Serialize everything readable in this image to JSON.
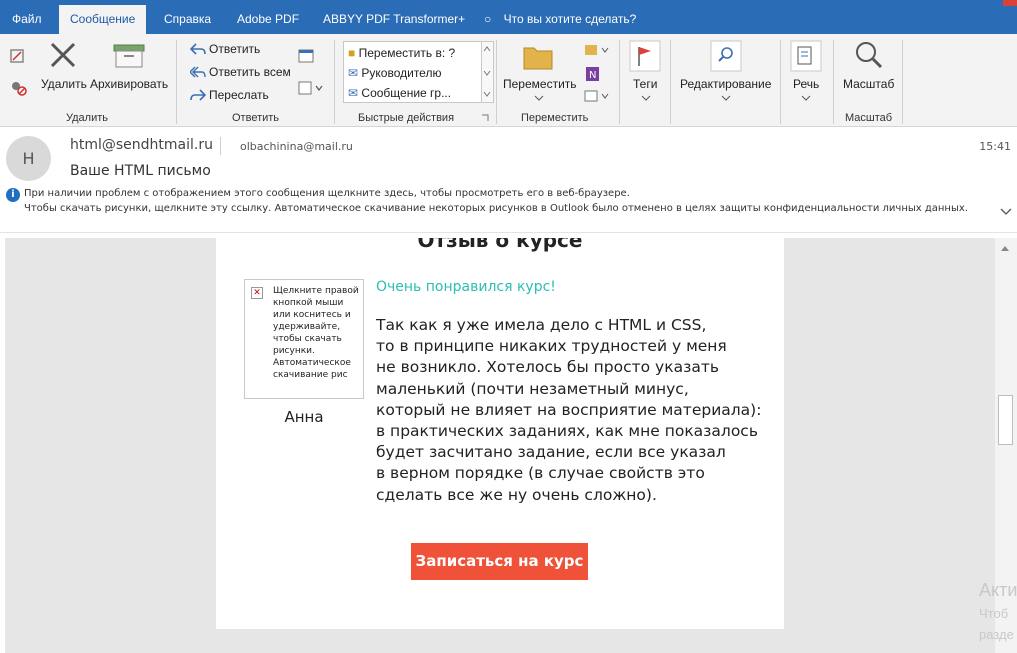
{
  "tabs": [
    {
      "label": "Файл"
    },
    {
      "label": "Сообщение"
    },
    {
      "label": "Справка"
    },
    {
      "label": "Adobe PDF"
    },
    {
      "label": "ABBYY PDF Transformer+"
    },
    {
      "label": "Что вы хотите сделать?"
    }
  ],
  "ribbon": {
    "delete_group": {
      "delete_label": "Удалить",
      "archive_label": "Архивировать",
      "group_label": "Удалить"
    },
    "respond_group": {
      "reply": "Ответить",
      "reply_all": "Ответить всем",
      "forward": "Переслать",
      "group_label": "Ответить"
    },
    "quick_steps": {
      "items": [
        "Переместить в: ?",
        "Руководителю",
        "Сообщение гр..."
      ],
      "group_label": "Быстрые действия"
    },
    "move_group": {
      "move_label": "Переместить",
      "group_label": "Переместить"
    },
    "tags_label": "Теги",
    "editing_label": "Редактирование",
    "speech_label": "Речь",
    "zoom": {
      "label": "Масштаб",
      "group_label": "Масштаб"
    }
  },
  "message": {
    "avatar_initial": "H",
    "sender": "html@sendhtmail.ru",
    "recipient": "olbachinina@mail.ru",
    "time": "15:41",
    "subject": "Ваше HTML письмо",
    "info_line1": "При наличии проблем с отображением этого сообщения щелкните здесь, чтобы просмотреть его в веб-браузере.",
    "info_line2": "Чтобы скачать рисунки, щелкните эту ссылку. Автоматическое скачивание некоторых рисунков в Outlook было отменено в целях защиты конфиденциальности личных данных."
  },
  "email_body": {
    "title": "Отзыв о курсе",
    "image_placeholder_text": "Щелкните правой кнопкой мыши или коснитесь и удерживайте, чтобы скачать рисунки. Автоматическое скачивание рис",
    "author": "Анна",
    "headline": "Очень понравился курс!",
    "review_lines": [
      "Так как я уже имела дело с HTML и CSS,",
      "то в принципе никаких трудностей у меня",
      "не возникло. Хотелось бы просто указать",
      "маленький (почти незаметный минус,",
      "который не влияет на восприятие материала):",
      "в практических заданиях, как мне показалось",
      "будет засчитано задание, если все указал",
      "в верном порядке (в случае свойств это",
      "сделать все же ну очень сложно)."
    ],
    "cta": "Записаться на курс",
    "headline_color": "#2bbfb0",
    "cta_color": "#f05239"
  },
  "watermark": {
    "line1": "Акти",
    "line2": "Чтоб",
    "line3": "разде"
  },
  "colors": {
    "accent": "#2b6cb6"
  }
}
